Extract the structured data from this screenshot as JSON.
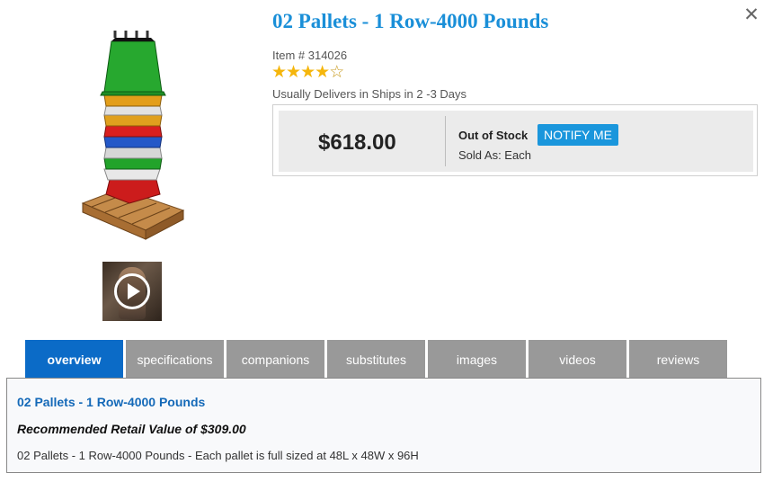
{
  "dialog": {
    "close_symbol": "✕"
  },
  "product": {
    "title": "02 Pallets - 1 Row-4000 Pounds",
    "item_number": "Item # 314026",
    "rating": 4,
    "rating_max": 5,
    "delivery": "Usually Delivers in Ships in 2 -3 Days",
    "image_icon": "stacked-containers-on-pallet-image",
    "video_icon": "play-icon"
  },
  "pricing": {
    "price": "$618.00",
    "stock_status": "Out of Stock",
    "notify_label": "NOTIFY ME",
    "sold_as": "Sold As: Each"
  },
  "tabs": [
    {
      "label": "overview",
      "active": true
    },
    {
      "label": "specifications",
      "active": false
    },
    {
      "label": "companions",
      "active": false
    },
    {
      "label": "substitutes",
      "active": false
    },
    {
      "label": "images",
      "active": false
    },
    {
      "label": "videos",
      "active": false
    },
    {
      "label": "reviews",
      "active": false
    }
  ],
  "overview": {
    "title": "02 Pallets - 1 Row-4000 Pounds",
    "retail_value": "Recommended Retail Value of $309.00",
    "description": "02 Pallets - 1 Row-4000 Pounds - Each pallet is full sized at 48L x 48W x 96H"
  },
  "colors": {
    "accent": "#1a8fd8",
    "active_tab": "#0b6bc7",
    "inactive_tab": "#999999",
    "notify_button": "#1a96dc",
    "star": "#f5b60c"
  }
}
